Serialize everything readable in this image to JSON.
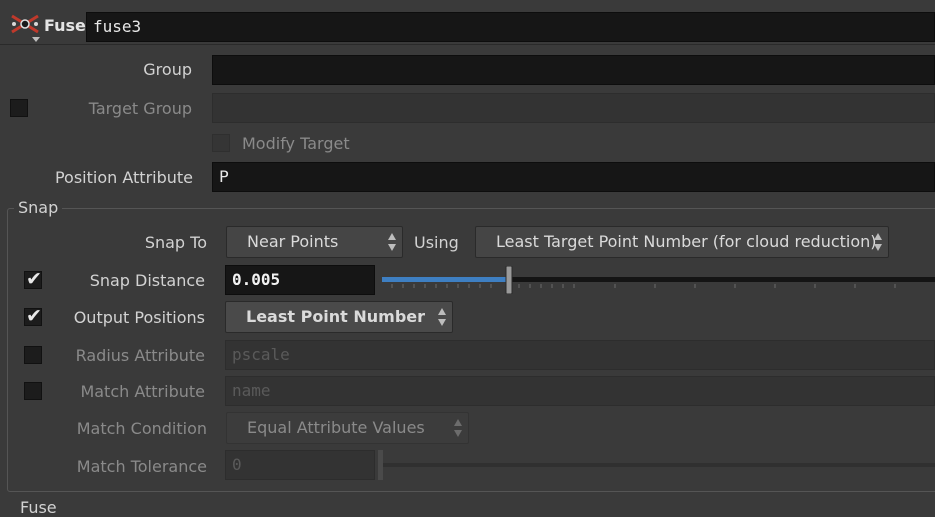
{
  "header": {
    "node_type": "Fuse",
    "node_name": "fuse3",
    "icon": "fuse-node-icon"
  },
  "group": {
    "label": "Group",
    "value": ""
  },
  "target_group": {
    "label": "Target Group",
    "value": "",
    "checked": false
  },
  "modify_target": {
    "label": "Modify Target",
    "checked": false
  },
  "position_attribute": {
    "label": "Position Attribute",
    "value": "P"
  },
  "snap": {
    "section_label": "Snap",
    "snap_to": {
      "label": "Snap To",
      "value": "Near Points"
    },
    "using": {
      "label": "Using",
      "value": "Least Target Point Number (for cloud reduction)"
    },
    "snap_distance": {
      "label": "Snap Distance",
      "value": "0.005",
      "checked": true,
      "slider_fraction": 0.23
    },
    "output_positions": {
      "label": "Output Positions",
      "value": "Least Point Number",
      "checked": true
    },
    "radius_attribute": {
      "label": "Radius Attribute",
      "value": "pscale",
      "checked": false
    },
    "match_attribute": {
      "label": "Match Attribute",
      "value": "name",
      "checked": false
    },
    "match_condition": {
      "label": "Match Condition",
      "value": "Equal Attribute Values"
    },
    "match_tolerance": {
      "label": "Match Tolerance",
      "value": "0"
    }
  },
  "fuse_section": {
    "label": "Fuse"
  },
  "colors": {
    "background": "#3a3a3a",
    "field": "#161616",
    "slider_fill": "#3e7fc2"
  }
}
